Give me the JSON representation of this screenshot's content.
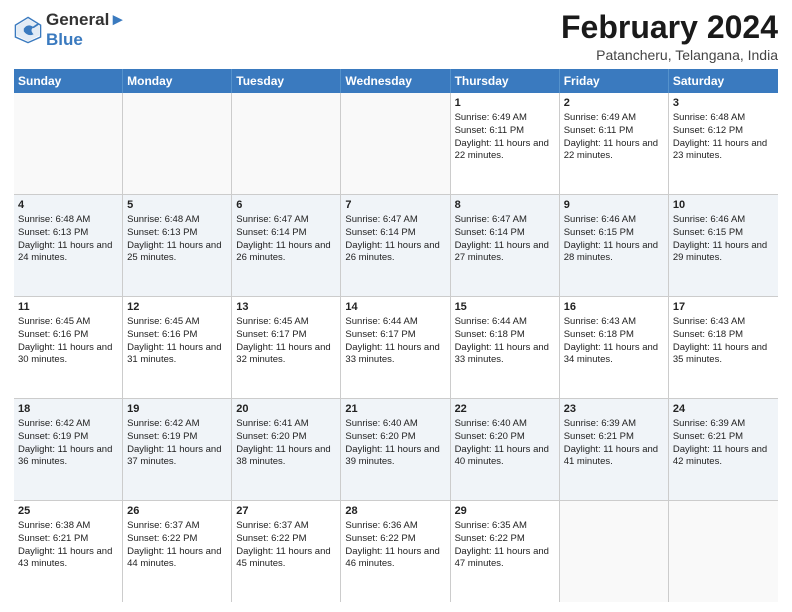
{
  "logo": {
    "line1": "General",
    "line2": "Blue"
  },
  "title": "February 2024",
  "subtitle": "Patancheru, Telangana, India",
  "days_of_week": [
    "Sunday",
    "Monday",
    "Tuesday",
    "Wednesday",
    "Thursday",
    "Friday",
    "Saturday"
  ],
  "weeks": [
    [
      {
        "day": "",
        "data": ""
      },
      {
        "day": "",
        "data": ""
      },
      {
        "day": "",
        "data": ""
      },
      {
        "day": "",
        "data": ""
      },
      {
        "day": "1",
        "data": "Sunrise: 6:49 AM\nSunset: 6:11 PM\nDaylight: 11 hours and 22 minutes."
      },
      {
        "day": "2",
        "data": "Sunrise: 6:49 AM\nSunset: 6:11 PM\nDaylight: 11 hours and 22 minutes."
      },
      {
        "day": "3",
        "data": "Sunrise: 6:48 AM\nSunset: 6:12 PM\nDaylight: 11 hours and 23 minutes."
      }
    ],
    [
      {
        "day": "4",
        "data": "Sunrise: 6:48 AM\nSunset: 6:13 PM\nDaylight: 11 hours and 24 minutes."
      },
      {
        "day": "5",
        "data": "Sunrise: 6:48 AM\nSunset: 6:13 PM\nDaylight: 11 hours and 25 minutes."
      },
      {
        "day": "6",
        "data": "Sunrise: 6:47 AM\nSunset: 6:14 PM\nDaylight: 11 hours and 26 minutes."
      },
      {
        "day": "7",
        "data": "Sunrise: 6:47 AM\nSunset: 6:14 PM\nDaylight: 11 hours and 26 minutes."
      },
      {
        "day": "8",
        "data": "Sunrise: 6:47 AM\nSunset: 6:14 PM\nDaylight: 11 hours and 27 minutes."
      },
      {
        "day": "9",
        "data": "Sunrise: 6:46 AM\nSunset: 6:15 PM\nDaylight: 11 hours and 28 minutes."
      },
      {
        "day": "10",
        "data": "Sunrise: 6:46 AM\nSunset: 6:15 PM\nDaylight: 11 hours and 29 minutes."
      }
    ],
    [
      {
        "day": "11",
        "data": "Sunrise: 6:45 AM\nSunset: 6:16 PM\nDaylight: 11 hours and 30 minutes."
      },
      {
        "day": "12",
        "data": "Sunrise: 6:45 AM\nSunset: 6:16 PM\nDaylight: 11 hours and 31 minutes."
      },
      {
        "day": "13",
        "data": "Sunrise: 6:45 AM\nSunset: 6:17 PM\nDaylight: 11 hours and 32 minutes."
      },
      {
        "day": "14",
        "data": "Sunrise: 6:44 AM\nSunset: 6:17 PM\nDaylight: 11 hours and 33 minutes."
      },
      {
        "day": "15",
        "data": "Sunrise: 6:44 AM\nSunset: 6:18 PM\nDaylight: 11 hours and 33 minutes."
      },
      {
        "day": "16",
        "data": "Sunrise: 6:43 AM\nSunset: 6:18 PM\nDaylight: 11 hours and 34 minutes."
      },
      {
        "day": "17",
        "data": "Sunrise: 6:43 AM\nSunset: 6:18 PM\nDaylight: 11 hours and 35 minutes."
      }
    ],
    [
      {
        "day": "18",
        "data": "Sunrise: 6:42 AM\nSunset: 6:19 PM\nDaylight: 11 hours and 36 minutes."
      },
      {
        "day": "19",
        "data": "Sunrise: 6:42 AM\nSunset: 6:19 PM\nDaylight: 11 hours and 37 minutes."
      },
      {
        "day": "20",
        "data": "Sunrise: 6:41 AM\nSunset: 6:20 PM\nDaylight: 11 hours and 38 minutes."
      },
      {
        "day": "21",
        "data": "Sunrise: 6:40 AM\nSunset: 6:20 PM\nDaylight: 11 hours and 39 minutes."
      },
      {
        "day": "22",
        "data": "Sunrise: 6:40 AM\nSunset: 6:20 PM\nDaylight: 11 hours and 40 minutes."
      },
      {
        "day": "23",
        "data": "Sunrise: 6:39 AM\nSunset: 6:21 PM\nDaylight: 11 hours and 41 minutes."
      },
      {
        "day": "24",
        "data": "Sunrise: 6:39 AM\nSunset: 6:21 PM\nDaylight: 11 hours and 42 minutes."
      }
    ],
    [
      {
        "day": "25",
        "data": "Sunrise: 6:38 AM\nSunset: 6:21 PM\nDaylight: 11 hours and 43 minutes."
      },
      {
        "day": "26",
        "data": "Sunrise: 6:37 AM\nSunset: 6:22 PM\nDaylight: 11 hours and 44 minutes."
      },
      {
        "day": "27",
        "data": "Sunrise: 6:37 AM\nSunset: 6:22 PM\nDaylight: 11 hours and 45 minutes."
      },
      {
        "day": "28",
        "data": "Sunrise: 6:36 AM\nSunset: 6:22 PM\nDaylight: 11 hours and 46 minutes."
      },
      {
        "day": "29",
        "data": "Sunrise: 6:35 AM\nSunset: 6:22 PM\nDaylight: 11 hours and 47 minutes."
      },
      {
        "day": "",
        "data": ""
      },
      {
        "day": "",
        "data": ""
      }
    ]
  ]
}
